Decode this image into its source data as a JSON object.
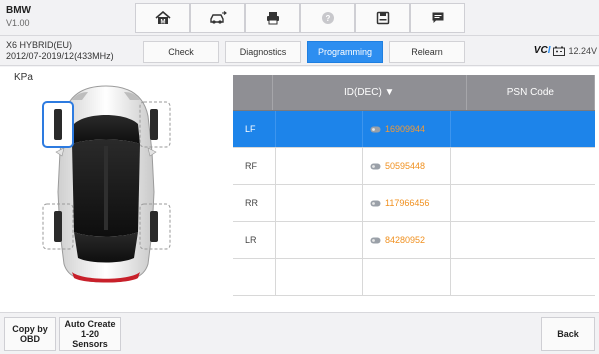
{
  "header": {
    "make": "BMW",
    "version": "V1.00"
  },
  "nav": [
    {
      "name": "home-icon"
    },
    {
      "name": "vehicle-swap-icon"
    },
    {
      "name": "print-icon"
    },
    {
      "name": "help-icon"
    },
    {
      "name": "save-icon"
    },
    {
      "name": "chat-icon"
    }
  ],
  "vehicle": {
    "model": "X6 HYBRID(EU)",
    "range": "2012/07-2019/12(433MHz)"
  },
  "tabs": {
    "check": "Check",
    "diagnostics": "Diagnostics",
    "programming": "Programming",
    "relearn": "Relearn",
    "active": "Programming"
  },
  "status": {
    "vci_label": "VCI",
    "time": "12.24V"
  },
  "unit": "KPa",
  "table": {
    "id_header": "ID(DEC) ▼",
    "psn_header": "PSN Code",
    "rows": [
      {
        "pos": "LF",
        "id": "16909944",
        "psn": ""
      },
      {
        "pos": "RF",
        "id": "50595448",
        "psn": ""
      },
      {
        "pos": "RR",
        "id": "117966456",
        "psn": ""
      },
      {
        "pos": "LR",
        "id": "84280952",
        "psn": ""
      },
      {
        "pos": "",
        "id": "",
        "psn": ""
      }
    ],
    "selected_index": 0
  },
  "buttons": {
    "copy_by_obd_1": "Copy by",
    "copy_by_obd_2": "OBD",
    "auto_create_1": "Auto Create",
    "auto_create_2": "1-20",
    "auto_create_3": "Sensors",
    "back": "Back"
  },
  "colors": {
    "accent": "#2d8ef0",
    "id_text": "#f0901f",
    "header_bg": "#8f8f94"
  }
}
